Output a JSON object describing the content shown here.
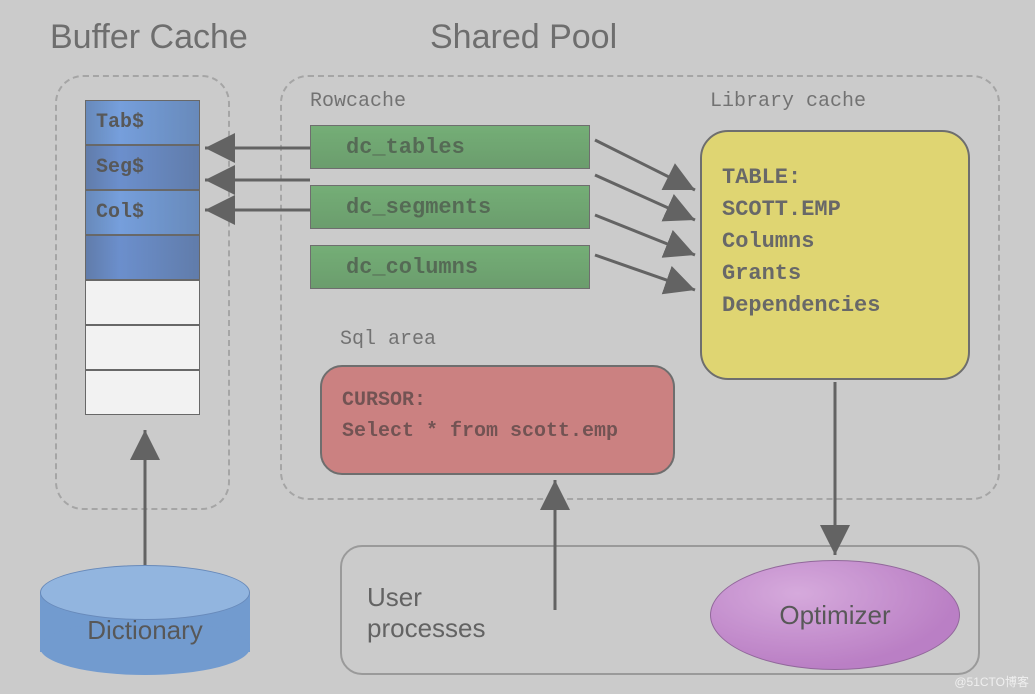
{
  "headings": {
    "buffer_cache": "Buffer Cache",
    "shared_pool": "Shared Pool"
  },
  "labels": {
    "rowcache": "Rowcache",
    "library_cache": "Library cache",
    "sql_area": "Sql area",
    "user_processes_line1": "User",
    "user_processes_line2": "processes"
  },
  "buffer_stack": {
    "items": [
      "Tab$",
      "Seg$",
      "Col$"
    ]
  },
  "dictionary": {
    "label": "Dictionary"
  },
  "rowcache": {
    "items": [
      "dc_tables",
      "dc_segments",
      "dc_columns"
    ]
  },
  "library_cache": {
    "lines": [
      "TABLE:",
      "SCOTT.EMP",
      "Columns",
      "Grants",
      "Dependencies"
    ]
  },
  "sql_area": {
    "lines": [
      "CURSOR:",
      "Select * from scott.emp"
    ]
  },
  "optimizer": {
    "label": "Optimizer"
  },
  "watermark": "@51CTO博客"
}
